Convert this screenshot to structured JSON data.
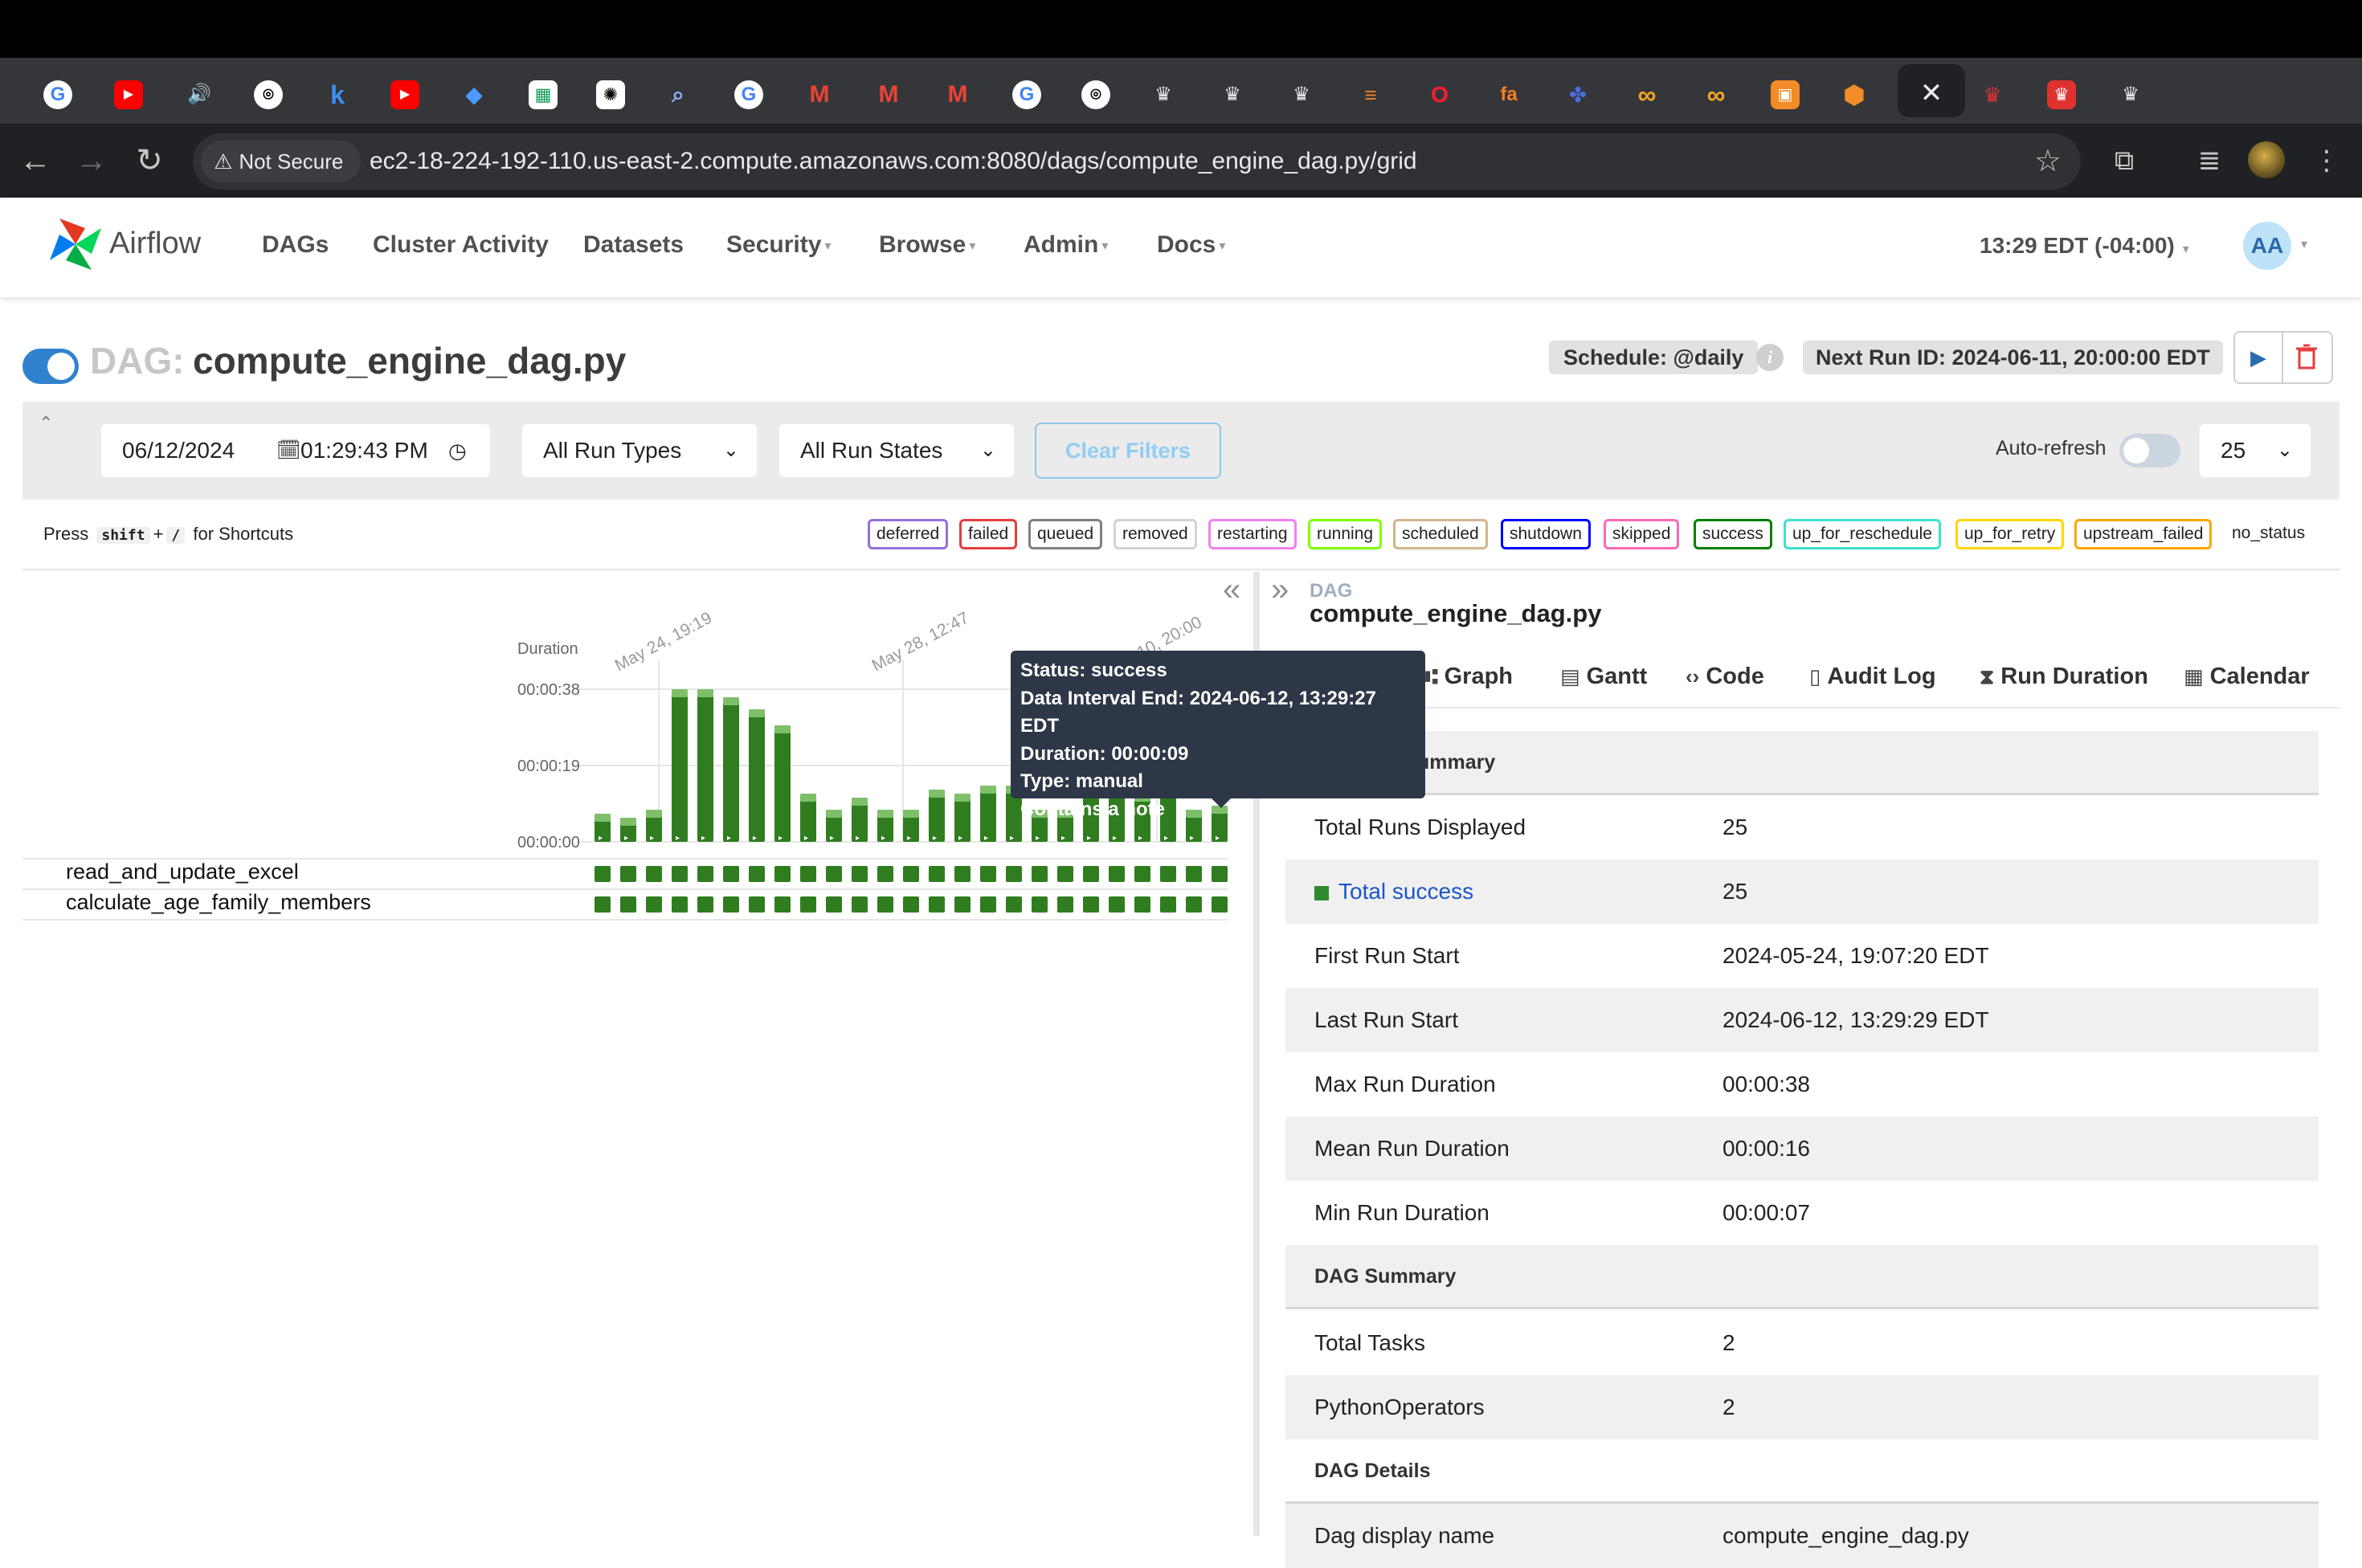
{
  "browser": {
    "not_secure_label": "Not Secure",
    "url": "ec2-18-224-192-110.us-east-2.compute.amazonaws.com:8080/dags/compute_engine_dag.py/grid",
    "tab_close_glyph": "✕",
    "new_tab_glyph": "+",
    "tab_icons": [
      "google-icon",
      "youtube-icon",
      "audio-icon",
      "github-icon",
      "k-icon",
      "youtube-icon",
      "jira-icon",
      "sheets-icon",
      "openai-icon",
      "search-icon",
      "google-icon",
      "gmail-icon",
      "gmail-icon",
      "gmail-icon",
      "google-icon",
      "github-icon",
      "crown-icon",
      "crown-icon",
      "crown-icon",
      "stackoverflow-icon",
      "opera-icon",
      "fa-icon",
      "slack-like-icon",
      "infinity-icon",
      "infinity-icon",
      "box-orange-icon",
      "cube-orange-icon",
      "active-tab",
      "crown-red-icon",
      "crown-red-box-icon",
      "crown-icon"
    ]
  },
  "airflow_header": {
    "brand": "Airflow",
    "nav": {
      "dags": "DAGs",
      "cluster_activity": "Cluster Activity",
      "datasets": "Datasets",
      "security": "Security",
      "browse": "Browse",
      "admin": "Admin",
      "docs": "Docs"
    },
    "clock": "13:29 EDT (-04:00)",
    "avatar_initials": "AA"
  },
  "dag": {
    "prefix": "DAG:",
    "name": "compute_engine_dag.py",
    "schedule": "Schedule: @daily",
    "next_run": "Next Run ID: 2024-06-11, 20:00:00 EDT"
  },
  "filters": {
    "date": "06/12/2024",
    "time": "01:29:43 PM",
    "run_types": "All Run Types",
    "run_states": "All Run States",
    "clear_filters": "Clear Filters",
    "auto_refresh": "Auto-refresh",
    "auto_refresh_on": false,
    "page_size": "25"
  },
  "shortcuts": {
    "press": "Press",
    "key1": "shift",
    "plus": "+",
    "key2": "/",
    "suffix": "for Shortcuts"
  },
  "legend": [
    {
      "label": "deferred",
      "color": "#9370db"
    },
    {
      "label": "failed",
      "color": "#e53e3e"
    },
    {
      "label": "queued",
      "color": "#808080"
    },
    {
      "label": "removed",
      "color": "#d3d3d3"
    },
    {
      "label": "restarting",
      "color": "#ee82ee"
    },
    {
      "label": "running",
      "color": "#7fff00"
    },
    {
      "label": "scheduled",
      "color": "#d2b48c"
    },
    {
      "label": "shutdown",
      "color": "#0000ff"
    },
    {
      "label": "skipped",
      "color": "#ff69b4"
    },
    {
      "label": "success",
      "color": "#008000"
    },
    {
      "label": "up_for_reschedule",
      "color": "#40e0d0"
    },
    {
      "label": "up_for_retry",
      "color": "#ffd700"
    },
    {
      "label": "upstream_failed",
      "color": "#ffa500"
    }
  ],
  "legend_no_status": "no_status",
  "grid": {
    "duration_label": "Duration",
    "date_labels": [
      "May 24, 19:19",
      "May 28, 12:47",
      "10, 20:00"
    ],
    "tasks": [
      "read_and_update_excel",
      "calculate_age_family_members"
    ],
    "collapse_glyph": "«",
    "expand_glyph": "»"
  },
  "chart_data": {
    "type": "bar",
    "ylabel": "Duration",
    "y_ticks": [
      "00:00:00",
      "00:00:19",
      "00:00:38"
    ],
    "ylim_seconds": [
      0,
      38
    ],
    "run_states": "success",
    "values_seconds": [
      7,
      6,
      8,
      38,
      38,
      36,
      33,
      29,
      12,
      8,
      11,
      8,
      8,
      13,
      12,
      14,
      14,
      8,
      8,
      16,
      16,
      12,
      13,
      8,
      9
    ],
    "x_labels": [
      "May 24, 19:19",
      "May 28, 12:47",
      "10, 20:00"
    ],
    "series_color": "#2f7d1f"
  },
  "tooltip": {
    "status": "Status: success",
    "interval_end": "Data Interval End: 2024-06-12, 13:29:27 EDT",
    "duration": "Duration: 00:00:09",
    "type": "Type: manual",
    "note": "Contains a note"
  },
  "details": {
    "crumb_label": "DAG",
    "crumb_name": "compute_engine_dag.py",
    "tabs": {
      "graph": "Graph",
      "gantt": "Gantt",
      "code": "Code",
      "audit_log": "Audit Log",
      "run_duration": "Run Duration",
      "calendar": "Calendar"
    },
    "dag_runs_summary_header": "ummary",
    "rows": {
      "total_runs_k": "Total Runs Displayed",
      "total_runs_v": "25",
      "total_success_k": "Total success",
      "total_success_v": "25",
      "first_run_k": "First Run Start",
      "first_run_v": "2024-05-24, 19:07:20 EDT",
      "last_run_k": "Last Run Start",
      "last_run_v": "2024-06-12, 13:29:29 EDT",
      "max_k": "Max Run Duration",
      "max_v": "00:00:38",
      "mean_k": "Mean Run Duration",
      "mean_v": "00:00:16",
      "min_k": "Min Run Duration",
      "min_v": "00:00:07"
    },
    "dag_summary_header": "DAG Summary",
    "dag_rows": {
      "total_tasks_k": "Total Tasks",
      "total_tasks_v": "2",
      "python_ops_k": "PythonOperators",
      "python_ops_v": "2"
    },
    "dag_details_header": "DAG Details",
    "display_name_k": "Dag display name",
    "display_name_v": "compute_engine_dag.py"
  }
}
